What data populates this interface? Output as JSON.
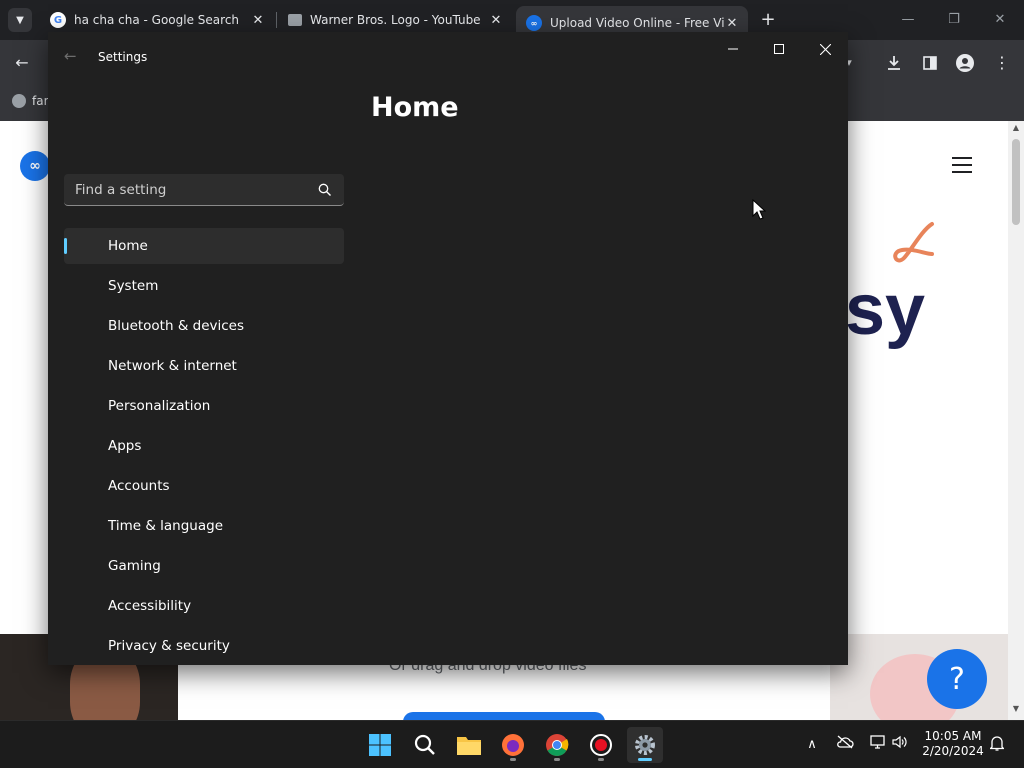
{
  "browser": {
    "tabs": [
      {
        "title": "ha cha cha - Google Search",
        "favicon": "google-icon"
      },
      {
        "title": "Warner Bros. Logo - YouTube",
        "favicon": "image-icon"
      },
      {
        "title": "Upload Video Online - Free Vid",
        "favicon": "link-icon"
      }
    ],
    "bookmark_label": "far",
    "page": {
      "hero_fragment": "sy",
      "drag_text": "Or drag and drop video files",
      "help_label": "?"
    }
  },
  "settings": {
    "window_title": "Settings",
    "page_heading": "Home",
    "search_placeholder": "Find a setting",
    "nav_items": [
      "Home",
      "System",
      "Bluetooth & devices",
      "Network & internet",
      "Personalization",
      "Apps",
      "Accounts",
      "Time & language",
      "Gaming",
      "Accessibility",
      "Privacy & security"
    ],
    "selected_item": "Home",
    "accent_color": "#60cdff"
  },
  "taskbar": {
    "time": "10:05 AM",
    "date": "2/20/2024"
  }
}
